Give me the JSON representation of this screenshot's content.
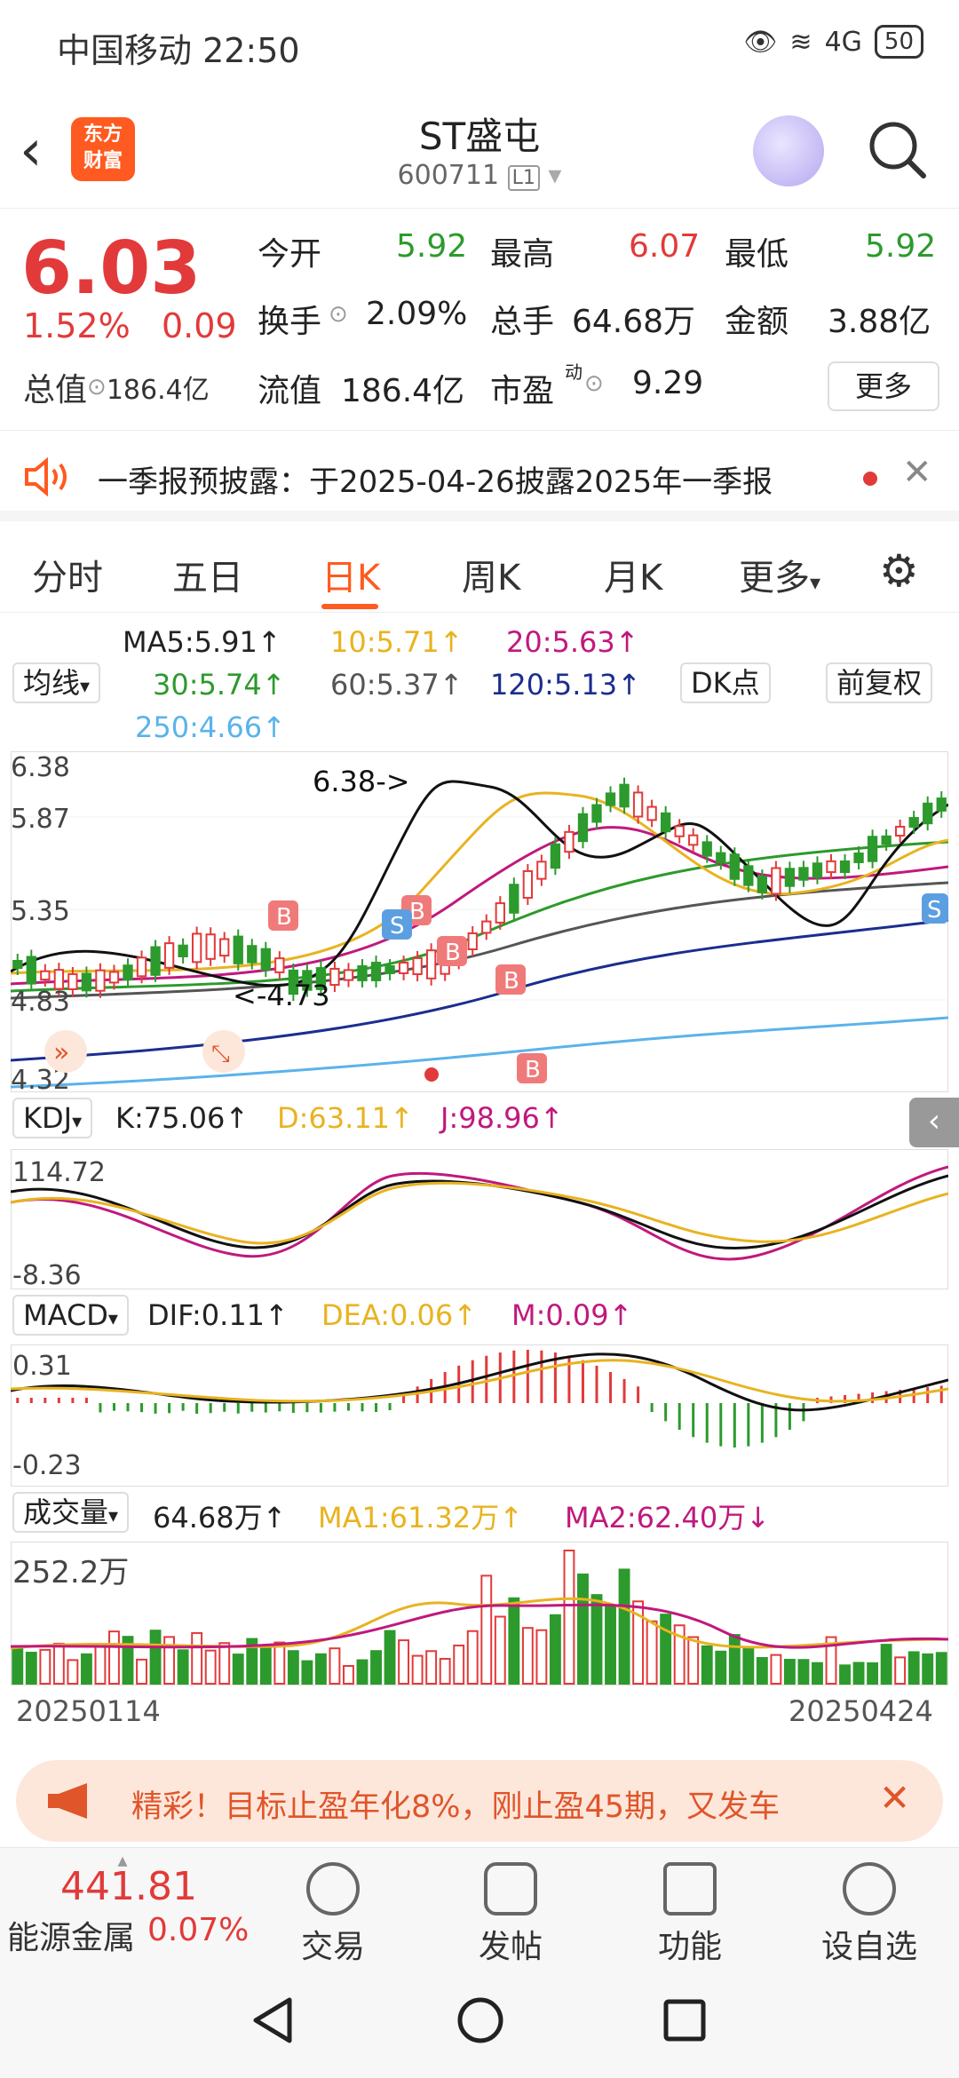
{
  "status": {
    "carrier_time": "中国移动 22:50",
    "battery": "50",
    "network": "4G"
  },
  "header": {
    "logo_line1": "东方",
    "logo_line2": "财富",
    "title": "ST盛屯",
    "code": "600711",
    "level": "L1"
  },
  "quote": {
    "price": "6.03",
    "pct": "1.52%",
    "change": "0.09",
    "total_value_label": "总值",
    "total_value": "186.4亿",
    "open_label": "今开",
    "open": "5.92",
    "high_label": "最高",
    "high": "6.07",
    "low_label": "最低",
    "low": "5.92",
    "turnover_label": "换手",
    "turnover": "2.09%",
    "volume_label": "总手",
    "volume": "64.68万",
    "amount_label": "金额",
    "amount": "3.88亿",
    "float_label": "流值",
    "float": "186.4亿",
    "pe_label": "市盈",
    "pe_sup": "动",
    "pe": "9.29",
    "more": "更多"
  },
  "notice": {
    "text": "一季报预披露：于2025-04-26披露2025年一季报"
  },
  "tabs": [
    "分时",
    "五日",
    "日K",
    "周K",
    "月K",
    "更多"
  ],
  "ma_legend": {
    "selector": "均线",
    "ma5": "MA5:5.91↑",
    "ma10": "10:5.71↑",
    "ma20": "20:5.63↑",
    "ma30": "30:5.74↑",
    "ma60": "60:5.37↑",
    "ma120": "120:5.13↑",
    "ma250": "250:4.66↑",
    "dk": "DK点",
    "fq": "前复权"
  },
  "kline": {
    "y_top": "6.38",
    "y2": "5.87",
    "y3": "5.35",
    "y4": "4.83",
    "y_bottom": "4.32",
    "high_mark": "6.38->",
    "low_mark": "<-4.73"
  },
  "kdj": {
    "selector": "KDJ",
    "k": "K:75.06↑",
    "d": "D:63.11↑",
    "j": "J:98.96↑",
    "y_top": "114.72",
    "y_bottom": "-8.36"
  },
  "macd": {
    "selector": "MACD",
    "dif": "DIF:0.11↑",
    "dea": "DEA:0.06↑",
    "m": "M:0.09↑",
    "y_top": "0.31",
    "y_bottom": "-0.23"
  },
  "volume": {
    "selector": "成交量",
    "vol": "64.68万↑",
    "ma1": "MA1:61.32万↑",
    "ma2": "MA2:62.40万↓",
    "y_top": "252.2万",
    "date_start": "20250114",
    "date_end": "20250424"
  },
  "ad": {
    "text": "精彩！目标止盈年化8%，刚止盈45期，又发车"
  },
  "bottomnav": {
    "index_value": "441.81",
    "index_name": "能源金属",
    "index_pct": "0.07%",
    "trade": "交易",
    "post": "发帖",
    "func": "功能",
    "watch": "设自选"
  },
  "colors": {
    "accent": "#ff5a1f",
    "up": "#e23a3a",
    "down": "#2c9a2c",
    "ma10": "#e8b320",
    "ma20": "#c0197d",
    "ma120": "#1b2d8f",
    "ma250": "#5ab3ea"
  }
}
